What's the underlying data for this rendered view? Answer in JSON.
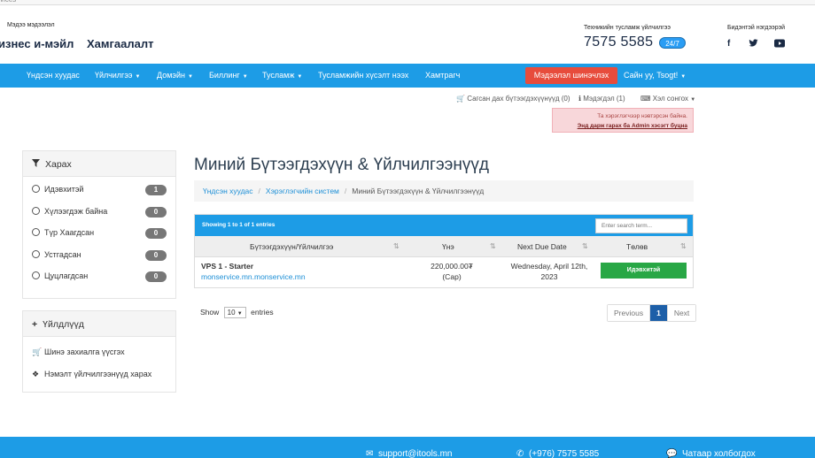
{
  "top_strip": {
    "text": "vices"
  },
  "header": {
    "info_label": "Мэдээ мэдээлэл",
    "business_email": "изнес и-мэйл",
    "security": "Хамгаалалт",
    "support_label": "Техникийн тусламж үйлчилгээ",
    "phone": "7575 5585",
    "phone_badge": "24/7",
    "social_label": "Бидэнтэй нэгдээрэй",
    "social_icons": [
      "facebook-icon",
      "twitter-icon",
      "youtube-icon"
    ]
  },
  "navbar": {
    "items": [
      "Үндсэн хуудас",
      "Үйлчилгээ",
      "Домэйн",
      "Биллинг",
      "Тусламж",
      "Тусламжийн хүсэлт нээх",
      "Хамтрагч"
    ],
    "notice_button": "Мэдээлэл шинэчлэх",
    "greeting": "Сайн уу, Tsogt!"
  },
  "utility": {
    "cart": "Сагсан дах бүтээгдэхүүнүүд (0)",
    "notifications": "Мэдэгдэл (1)",
    "language": "Хэл сонгох"
  },
  "alert": {
    "line1": "Та хэрэглэгчээр нэвтэрсэн байна.",
    "line2": "Энд дарж гарах ба Admin хэсэгт буцна"
  },
  "sidebar": {
    "filter_title": "Харах",
    "filters": [
      {
        "label": "Идэвхитэй",
        "count": "1"
      },
      {
        "label": "Хүлээгдэж байна",
        "count": "0"
      },
      {
        "label": "Түр Хаагдсан",
        "count": "0"
      },
      {
        "label": "Устгадсан",
        "count": "0"
      },
      {
        "label": "Цуцлагдсан",
        "count": "0"
      }
    ],
    "actions_title": "Үйлдлүүд",
    "actions": [
      "Шинэ захиалга үүсгэх",
      "Нэмэлт үйлчилгээнүүд харах"
    ]
  },
  "main": {
    "title": "Миний Бүтээгдэхүүн & Үйлчилгээнүүд",
    "breadcrumb": [
      "Үндсэн хуудас",
      "Хэрэглэгчийн систем",
      "Миний Бүтээгдэхүүн & Үйлчилгээнүүд"
    ],
    "table": {
      "info": "Showing 1 to 1 of 1 entries",
      "search_placeholder": "Enter search term...",
      "headers": [
        "Бүтээгдэхүүн/Үйлчилгээ",
        "Үнэ",
        "Next Due Date",
        "Төлөв"
      ],
      "rows": [
        {
          "name": "VPS 1 - Starter",
          "domain": "monservice.mn.monservice.mn",
          "price": "220,000.00₮",
          "cycle": "(Сар)",
          "due_line1": "Wednesday, April 12th,",
          "due_line2": "2023",
          "status": "Идэвхитэй"
        }
      ]
    },
    "show_label": "Show",
    "show_value": "10",
    "entries_label": "entries",
    "pager": {
      "prev": "Previous",
      "current": "1",
      "next": "Next"
    }
  },
  "footer": {
    "email": "support@itools.mn",
    "phone": "(+976) 7575 5585",
    "chat": "Чатаар холбогдох"
  },
  "colors": {
    "primary": "#1d9ce6",
    "danger": "#e74c3c",
    "success": "#28a745"
  }
}
